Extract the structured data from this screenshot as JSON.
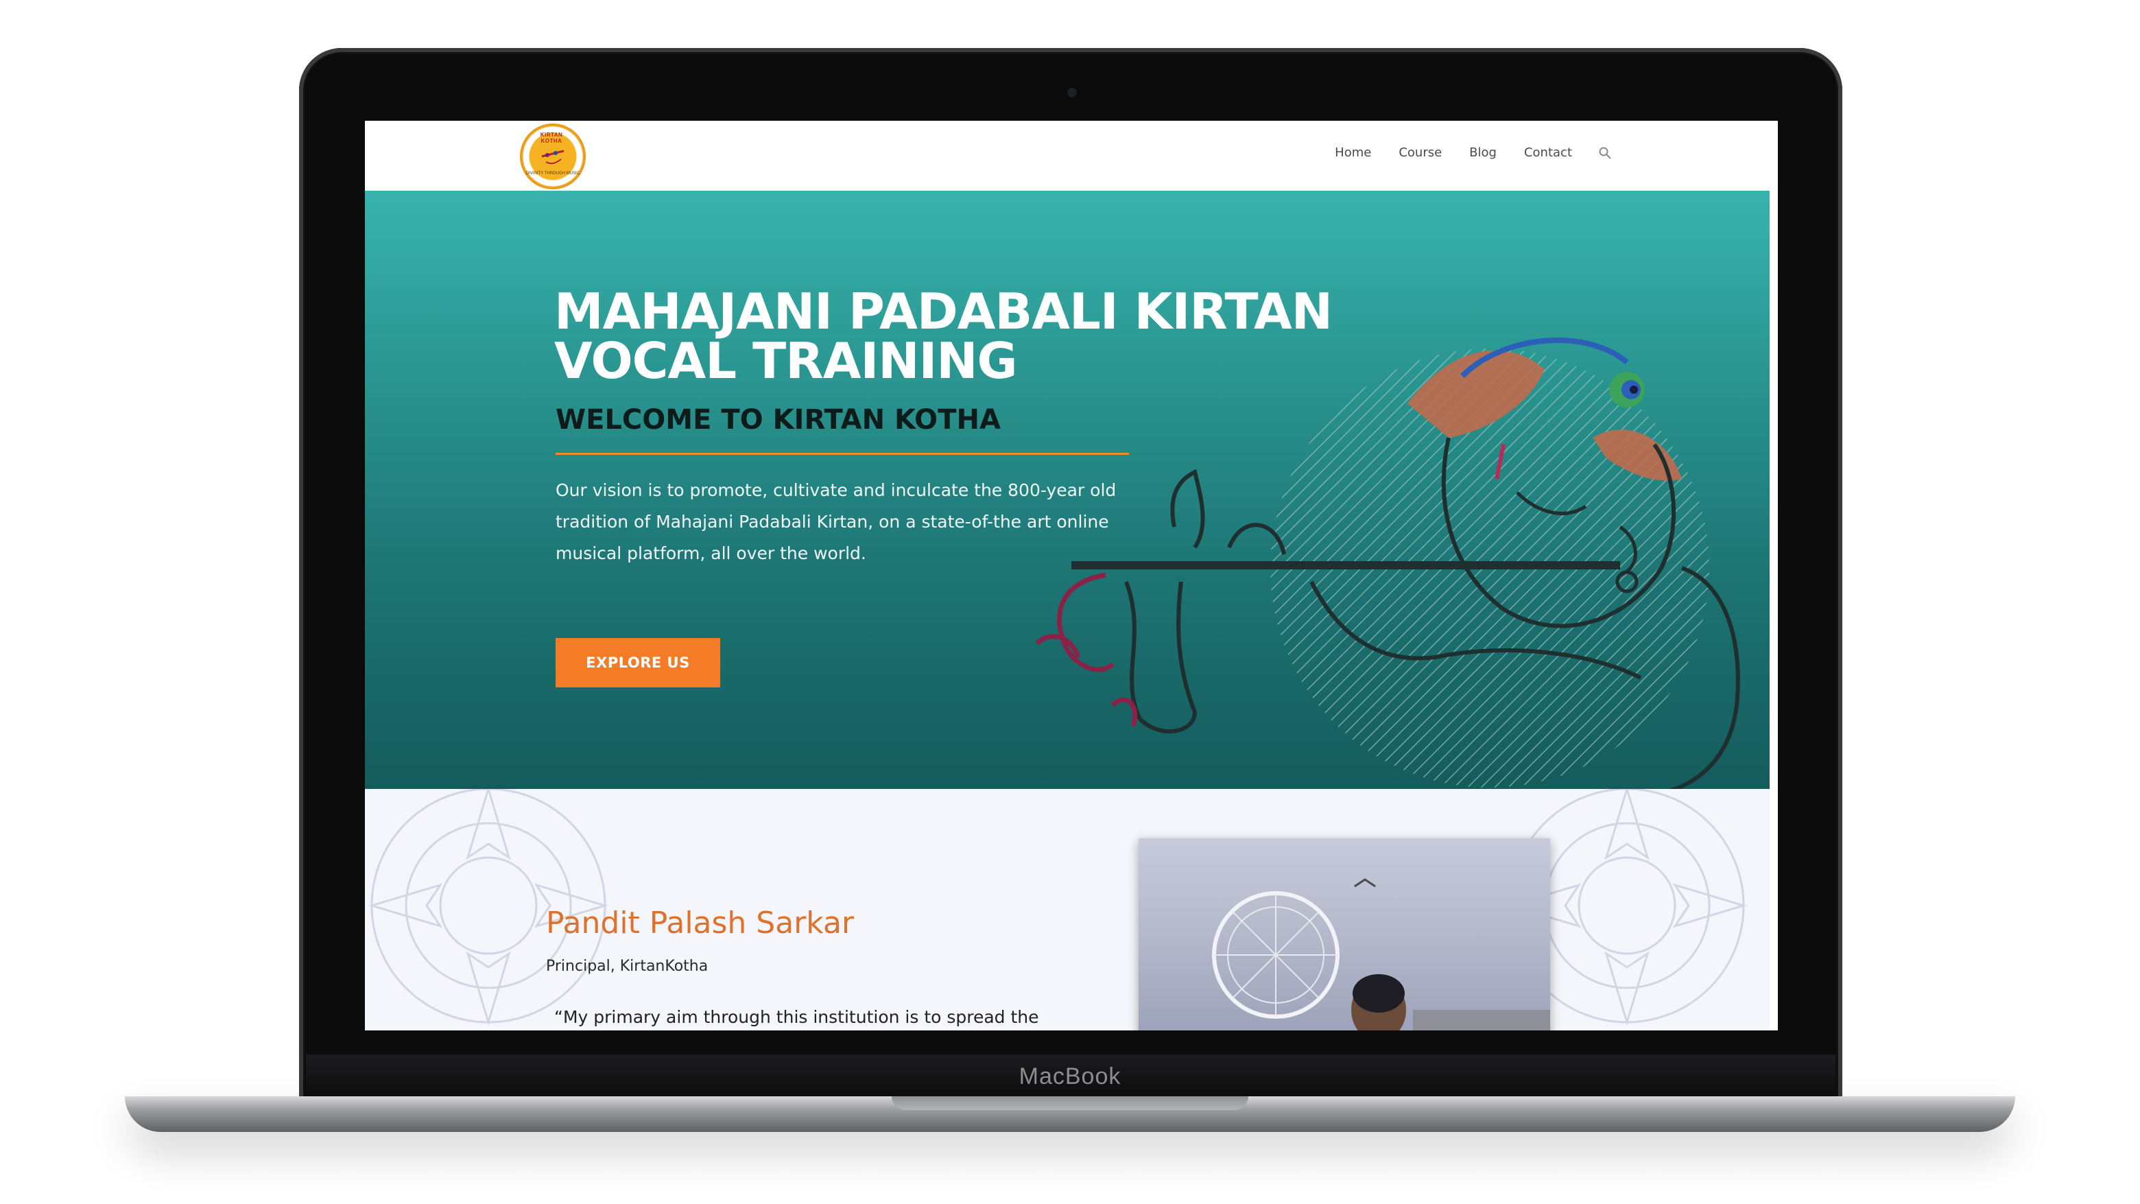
{
  "device": {
    "brand_label": "MacBook"
  },
  "site": {
    "logo": {
      "ring_text": "KIRTAN KOTHA",
      "tagline": "DIVINITY THROUGH MUSIC"
    },
    "nav": {
      "items": [
        "Home",
        "Course",
        "Blog",
        "Contact"
      ],
      "search_icon": "search-icon"
    },
    "hero": {
      "title": "MAHAJANI PADABALI KIRTAN VOCAL TRAINING",
      "subtitle": "WELCOME TO KIRTAN KOTHA",
      "body": "Our vision is to promote, cultivate and inculcate the 800-year old tradition of Mahajani Padabali Kirtan, on a state-of-the art online musical platform, all over the world.",
      "cta_label": "EXPLORE US",
      "illustration": "krishna-flute-illustration"
    },
    "about": {
      "name": "Pandit Palash Sarkar",
      "role": "Principal, KirtanKotha",
      "quote": "“My primary aim through this institution is to spread the",
      "photo": "portrait-photo-london-eye"
    }
  },
  "colors": {
    "accent": "#f57c27",
    "hero_top": "#39b3ad",
    "hero_bottom": "#155b5c",
    "heading_orange": "#e0712b"
  }
}
